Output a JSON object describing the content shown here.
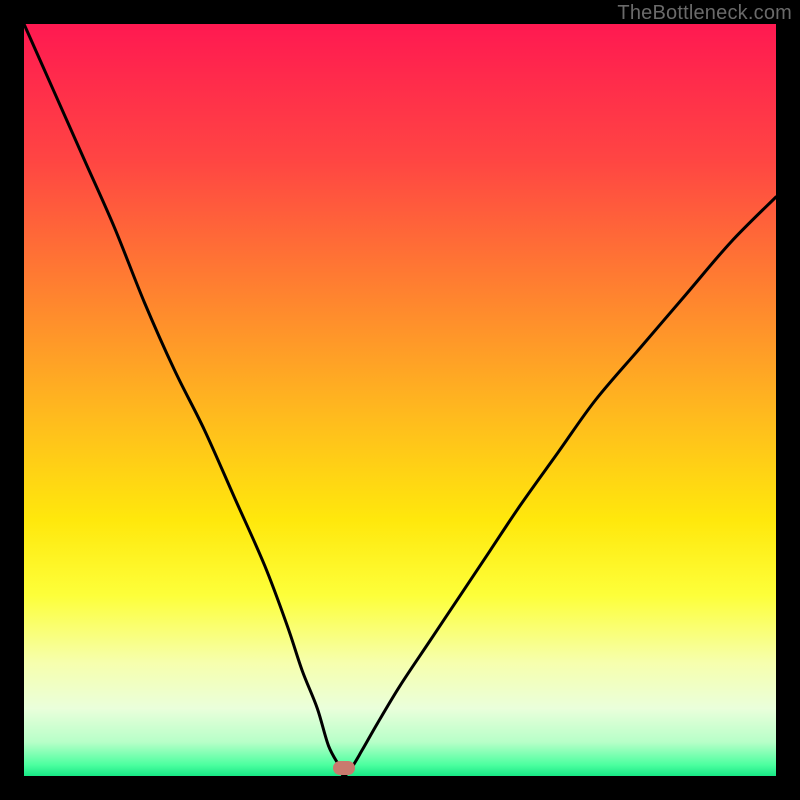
{
  "watermark": "TheBottleneck.com",
  "marker": {
    "color": "#c97a6e",
    "x_pct": 42.5,
    "y_pct": 99.0
  },
  "gradient_stops": [
    {
      "offset": 0.0,
      "color": "#ff1951"
    },
    {
      "offset": 0.18,
      "color": "#ff4543"
    },
    {
      "offset": 0.38,
      "color": "#ff8a2d"
    },
    {
      "offset": 0.52,
      "color": "#ffba1e"
    },
    {
      "offset": 0.66,
      "color": "#ffe80c"
    },
    {
      "offset": 0.76,
      "color": "#fdff3a"
    },
    {
      "offset": 0.85,
      "color": "#f6ffae"
    },
    {
      "offset": 0.91,
      "color": "#eaffdb"
    },
    {
      "offset": 0.955,
      "color": "#b7ffc8"
    },
    {
      "offset": 0.985,
      "color": "#4dffa0"
    },
    {
      "offset": 1.0,
      "color": "#17e885"
    }
  ],
  "chart_data": {
    "type": "line",
    "title": "",
    "xlabel": "",
    "ylabel": "",
    "xlim": [
      0,
      100
    ],
    "ylim": [
      0,
      100
    ],
    "series": [
      {
        "name": "bottleneck-curve",
        "x": [
          0,
          4,
          8,
          12,
          16,
          20,
          24,
          28,
          32,
          35,
          37,
          39,
          40.5,
          42,
          42.5,
          43.5,
          45,
          47,
          50,
          54,
          58,
          62,
          66,
          71,
          76,
          82,
          88,
          94,
          100
        ],
        "y": [
          100,
          91,
          82,
          73,
          63,
          54,
          46,
          37,
          28,
          20,
          14,
          9,
          4,
          1.2,
          0,
          1.0,
          3.5,
          7,
          12,
          18,
          24,
          30,
          36,
          43,
          50,
          57,
          64,
          71,
          77
        ]
      }
    ],
    "annotations": [
      {
        "name": "optimum-marker",
        "x": 42.5,
        "y": 0
      }
    ],
    "grid": false,
    "legend": false
  }
}
